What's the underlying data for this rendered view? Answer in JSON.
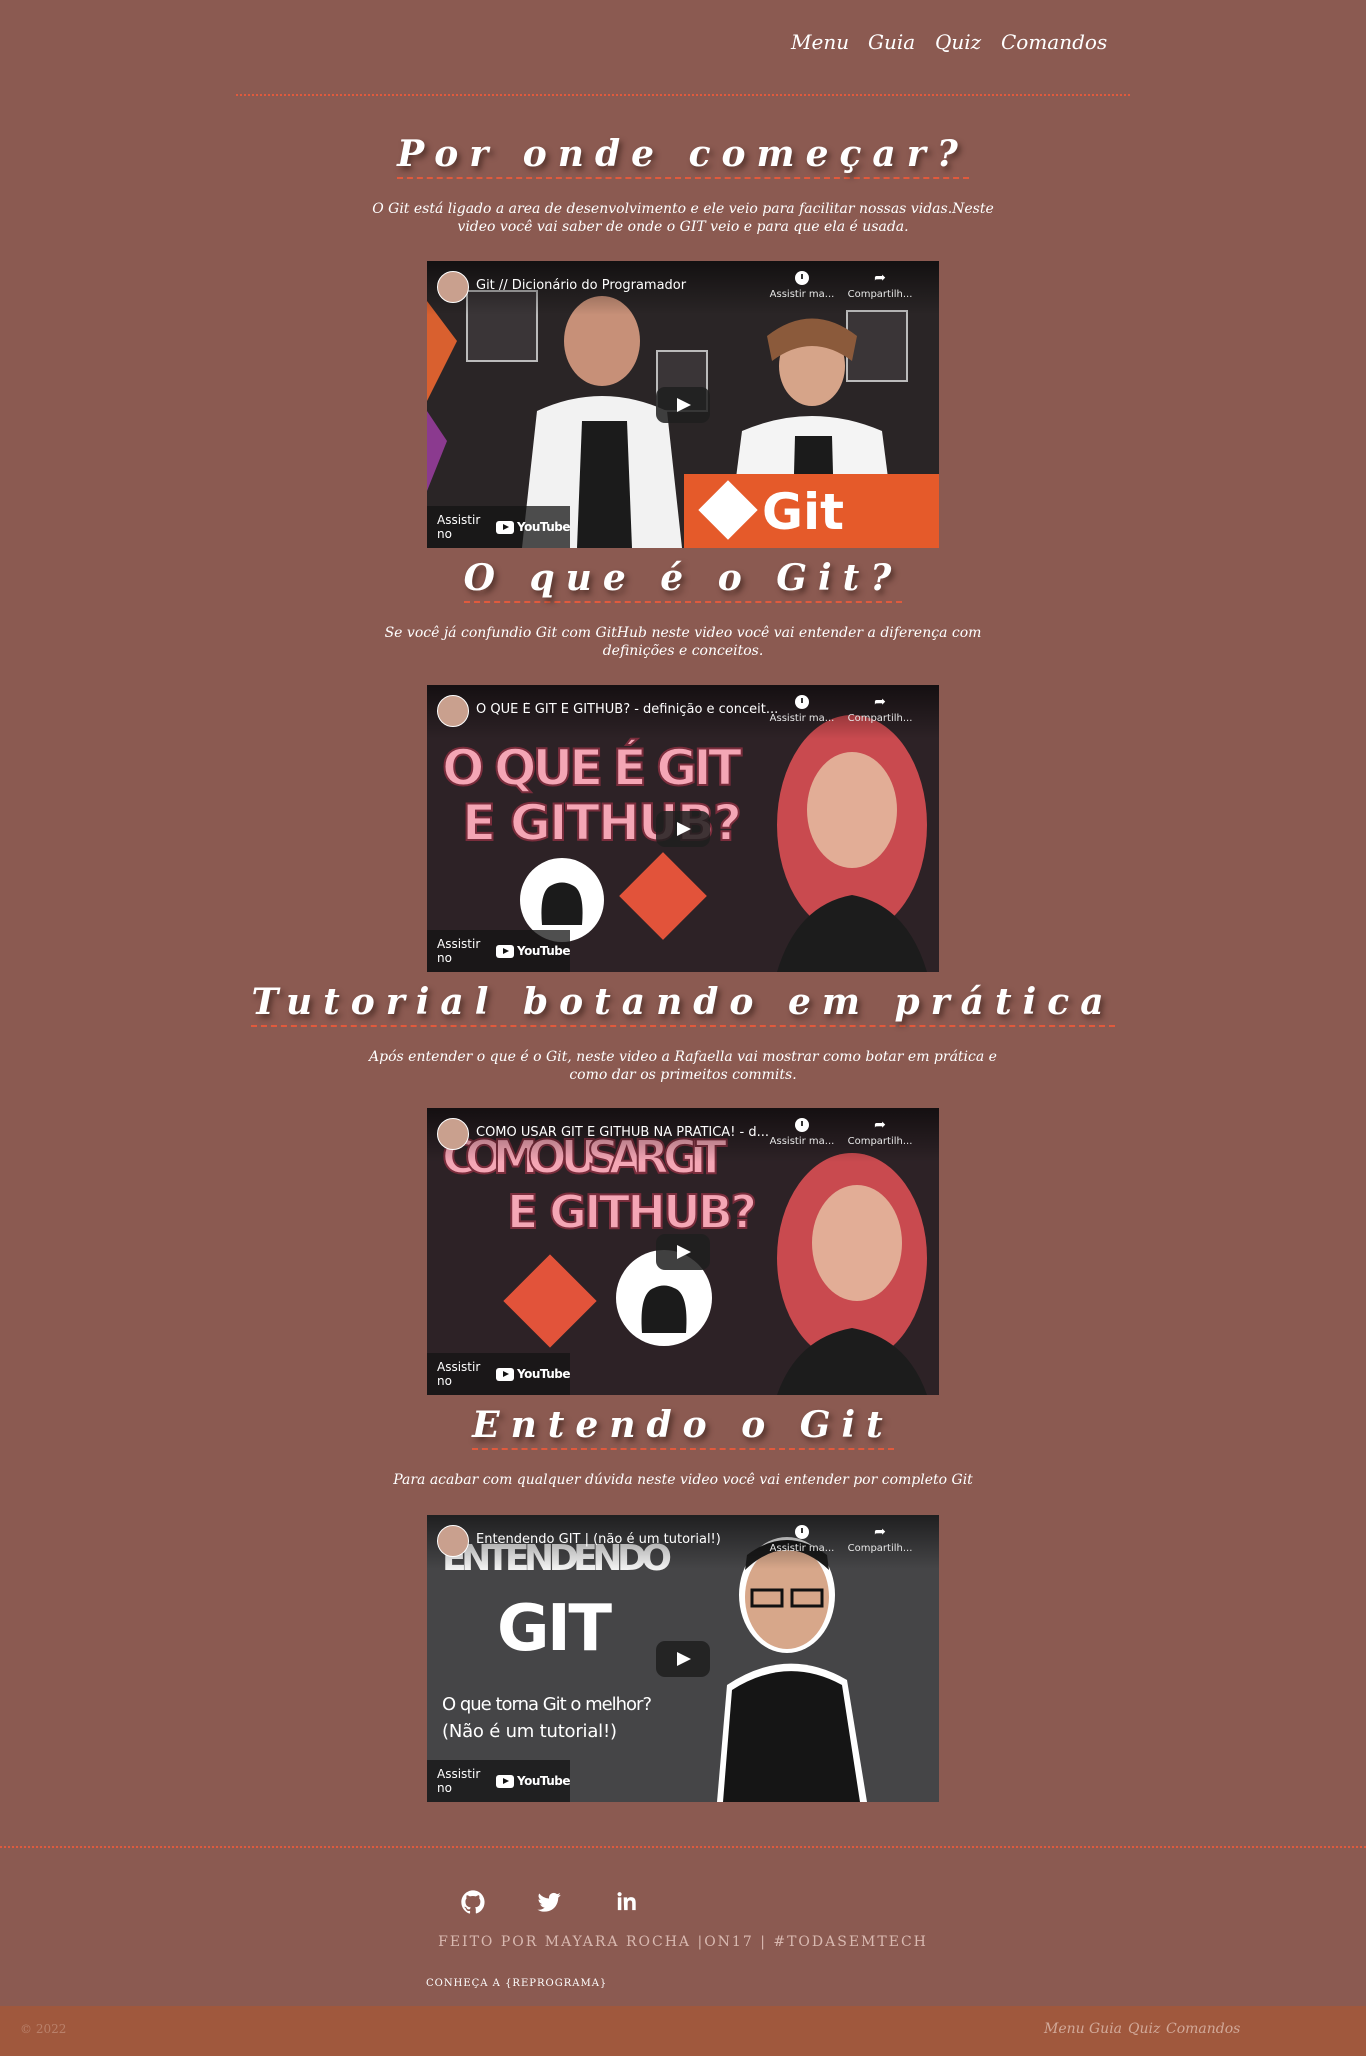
{
  "nav": {
    "items": [
      "Menu",
      "Guia",
      "Quiz",
      "Comandos"
    ]
  },
  "sections": [
    {
      "title": "Por onde começar?",
      "description": "O Git está ligado a area de desenvolvimento e ele veio para facilitar nossas vidas.Neste video você vai saber de onde o GIT veio e para que ela é usada.",
      "video_title": "Git // Dicionário do Programador",
      "thumb_text": "Git"
    },
    {
      "title": "O que é o Git?",
      "description": "Se você já confundio Git com GitHub neste video você vai entender a diferença com definições e conceitos.",
      "video_title": "O QUE É GIT E GITHUB? - definição e conceit...",
      "thumb_text": "O QUE É GIT E GITHUB?"
    },
    {
      "title": "Tutorial botando em prática",
      "description": "Após entender o que é o Git, neste video a Rafaella vai mostrar como botar em prática e como dar os primeitos commits.",
      "video_title": "COMO USAR GIT E GITHUB NA PRÁTICA! - d...",
      "thumb_text": "COMO USAR GIT E GITHUB?"
    },
    {
      "title": "Entendo o Git",
      "description": "Para acabar com qualquer dúvida neste video você vai entender por completo Git",
      "video_title": "Entendendo GIT | (não é um tutorial!)",
      "thumb_text": "ENTENDENDO GIT",
      "thumb_subtext": "O que torna Git o melhor? (Não é um tutorial!)"
    }
  ],
  "video_controls": {
    "watch_later": "Assistir ma...",
    "share": "Compartilh...",
    "watch_on": "Assistir no",
    "youtube": "YouTube"
  },
  "footer": {
    "social": [
      "github-icon",
      "twitter-icon",
      "linkedin-icon"
    ],
    "credit": "FEITO POR MAYARA ROCHA |ON17 | #TODASEMTECH",
    "reprograma": "CONHEÇA A {REPROGRAMA}"
  },
  "bottom_bar": {
    "copyright": "© 2022",
    "nav": [
      "Menu",
      "Guia",
      "Quiz",
      "Comandos"
    ]
  },
  "colors": {
    "background": "#8b5a51",
    "accent": "#e05a3d",
    "bottom_bar": "#a0583d"
  }
}
